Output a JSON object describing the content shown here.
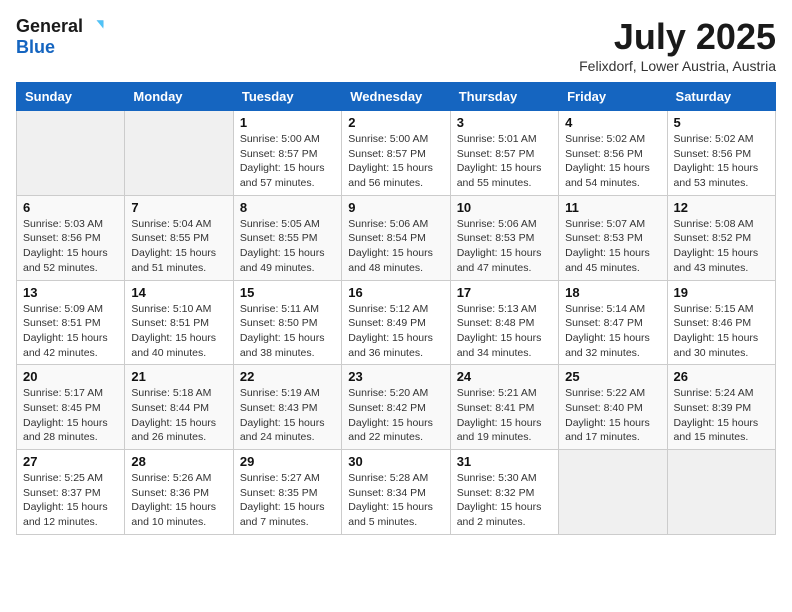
{
  "logo": {
    "general": "General",
    "blue": "Blue"
  },
  "title": "July 2025",
  "subtitle": "Felixdorf, Lower Austria, Austria",
  "weekdays": [
    "Sunday",
    "Monday",
    "Tuesday",
    "Wednesday",
    "Thursday",
    "Friday",
    "Saturday"
  ],
  "weeks": [
    [
      {
        "day": "",
        "info": ""
      },
      {
        "day": "",
        "info": ""
      },
      {
        "day": "1",
        "info": "Sunrise: 5:00 AM\nSunset: 8:57 PM\nDaylight: 15 hours\nand 57 minutes."
      },
      {
        "day": "2",
        "info": "Sunrise: 5:00 AM\nSunset: 8:57 PM\nDaylight: 15 hours\nand 56 minutes."
      },
      {
        "day": "3",
        "info": "Sunrise: 5:01 AM\nSunset: 8:57 PM\nDaylight: 15 hours\nand 55 minutes."
      },
      {
        "day": "4",
        "info": "Sunrise: 5:02 AM\nSunset: 8:56 PM\nDaylight: 15 hours\nand 54 minutes."
      },
      {
        "day": "5",
        "info": "Sunrise: 5:02 AM\nSunset: 8:56 PM\nDaylight: 15 hours\nand 53 minutes."
      }
    ],
    [
      {
        "day": "6",
        "info": "Sunrise: 5:03 AM\nSunset: 8:56 PM\nDaylight: 15 hours\nand 52 minutes."
      },
      {
        "day": "7",
        "info": "Sunrise: 5:04 AM\nSunset: 8:55 PM\nDaylight: 15 hours\nand 51 minutes."
      },
      {
        "day": "8",
        "info": "Sunrise: 5:05 AM\nSunset: 8:55 PM\nDaylight: 15 hours\nand 49 minutes."
      },
      {
        "day": "9",
        "info": "Sunrise: 5:06 AM\nSunset: 8:54 PM\nDaylight: 15 hours\nand 48 minutes."
      },
      {
        "day": "10",
        "info": "Sunrise: 5:06 AM\nSunset: 8:53 PM\nDaylight: 15 hours\nand 47 minutes."
      },
      {
        "day": "11",
        "info": "Sunrise: 5:07 AM\nSunset: 8:53 PM\nDaylight: 15 hours\nand 45 minutes."
      },
      {
        "day": "12",
        "info": "Sunrise: 5:08 AM\nSunset: 8:52 PM\nDaylight: 15 hours\nand 43 minutes."
      }
    ],
    [
      {
        "day": "13",
        "info": "Sunrise: 5:09 AM\nSunset: 8:51 PM\nDaylight: 15 hours\nand 42 minutes."
      },
      {
        "day": "14",
        "info": "Sunrise: 5:10 AM\nSunset: 8:51 PM\nDaylight: 15 hours\nand 40 minutes."
      },
      {
        "day": "15",
        "info": "Sunrise: 5:11 AM\nSunset: 8:50 PM\nDaylight: 15 hours\nand 38 minutes."
      },
      {
        "day": "16",
        "info": "Sunrise: 5:12 AM\nSunset: 8:49 PM\nDaylight: 15 hours\nand 36 minutes."
      },
      {
        "day": "17",
        "info": "Sunrise: 5:13 AM\nSunset: 8:48 PM\nDaylight: 15 hours\nand 34 minutes."
      },
      {
        "day": "18",
        "info": "Sunrise: 5:14 AM\nSunset: 8:47 PM\nDaylight: 15 hours\nand 32 minutes."
      },
      {
        "day": "19",
        "info": "Sunrise: 5:15 AM\nSunset: 8:46 PM\nDaylight: 15 hours\nand 30 minutes."
      }
    ],
    [
      {
        "day": "20",
        "info": "Sunrise: 5:17 AM\nSunset: 8:45 PM\nDaylight: 15 hours\nand 28 minutes."
      },
      {
        "day": "21",
        "info": "Sunrise: 5:18 AM\nSunset: 8:44 PM\nDaylight: 15 hours\nand 26 minutes."
      },
      {
        "day": "22",
        "info": "Sunrise: 5:19 AM\nSunset: 8:43 PM\nDaylight: 15 hours\nand 24 minutes."
      },
      {
        "day": "23",
        "info": "Sunrise: 5:20 AM\nSunset: 8:42 PM\nDaylight: 15 hours\nand 22 minutes."
      },
      {
        "day": "24",
        "info": "Sunrise: 5:21 AM\nSunset: 8:41 PM\nDaylight: 15 hours\nand 19 minutes."
      },
      {
        "day": "25",
        "info": "Sunrise: 5:22 AM\nSunset: 8:40 PM\nDaylight: 15 hours\nand 17 minutes."
      },
      {
        "day": "26",
        "info": "Sunrise: 5:24 AM\nSunset: 8:39 PM\nDaylight: 15 hours\nand 15 minutes."
      }
    ],
    [
      {
        "day": "27",
        "info": "Sunrise: 5:25 AM\nSunset: 8:37 PM\nDaylight: 15 hours\nand 12 minutes."
      },
      {
        "day": "28",
        "info": "Sunrise: 5:26 AM\nSunset: 8:36 PM\nDaylight: 15 hours\nand 10 minutes."
      },
      {
        "day": "29",
        "info": "Sunrise: 5:27 AM\nSunset: 8:35 PM\nDaylight: 15 hours\nand 7 minutes."
      },
      {
        "day": "30",
        "info": "Sunrise: 5:28 AM\nSunset: 8:34 PM\nDaylight: 15 hours\nand 5 minutes."
      },
      {
        "day": "31",
        "info": "Sunrise: 5:30 AM\nSunset: 8:32 PM\nDaylight: 15 hours\nand 2 minutes."
      },
      {
        "day": "",
        "info": ""
      },
      {
        "day": "",
        "info": ""
      }
    ]
  ]
}
